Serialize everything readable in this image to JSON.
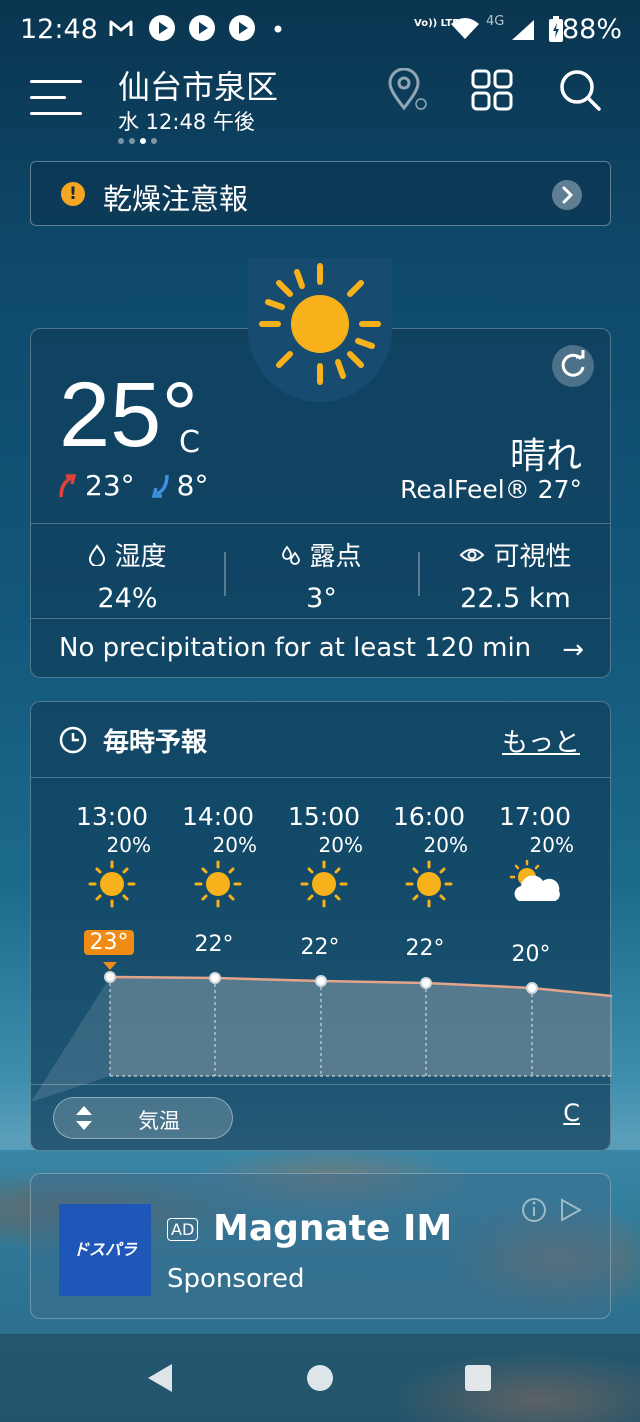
{
  "status_bar": {
    "time": "12:48",
    "battery": "88%",
    "network_label": "4G",
    "volte_label": "Vo)) LTE"
  },
  "header": {
    "location": "仙台市泉区",
    "datetime": "水 12:48 午後"
  },
  "alert": {
    "text": "乾燥注意報",
    "warn_glyph": "!"
  },
  "current": {
    "temp": "25°",
    "unit": "C",
    "high": "23°",
    "low": "8°",
    "condition": "晴れ",
    "realfeel": "RealFeel® 27°",
    "stats": [
      {
        "label": "湿度",
        "value": "24%",
        "icon": "humidity-icon"
      },
      {
        "label": "露点",
        "value": "3°",
        "icon": "dew-point-icon"
      },
      {
        "label": "可視性",
        "value": "22.5 km",
        "icon": "eye-icon"
      }
    ],
    "precip": "No precipitation for at least 120 min",
    "precip_arrow": "→"
  },
  "hourly": {
    "title": "毎時予報",
    "more": "もっと",
    "hours": [
      {
        "time": "13:00",
        "precip": "20%",
        "temp": "23°",
        "icon": "sun-icon",
        "highlight": true
      },
      {
        "time": "14:00",
        "precip": "20%",
        "temp": "22°",
        "icon": "sun-icon"
      },
      {
        "time": "15:00",
        "precip": "20%",
        "temp": "22°",
        "icon": "sun-icon"
      },
      {
        "time": "16:00",
        "precip": "20%",
        "temp": "22°",
        "icon": "sun-icon"
      },
      {
        "time": "17:00",
        "precip": "20%",
        "temp": "20°",
        "icon": "partly-cloudy-icon"
      }
    ],
    "toggle_label": "気温",
    "unit_label": "C"
  },
  "ad": {
    "badge": "AD",
    "name": "Magnate IM",
    "sponsored": "Sponsored",
    "logo_text": "ドスパラ"
  },
  "colors": {
    "accent": "#f08c16",
    "sun": "#f7b21b",
    "ad_logo": "#1f57b8"
  }
}
